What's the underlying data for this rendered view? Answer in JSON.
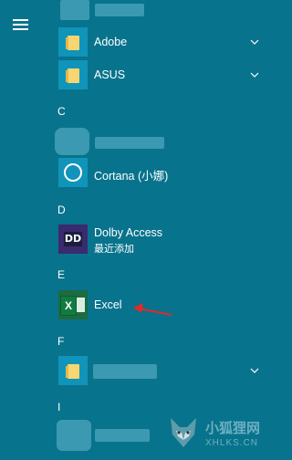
{
  "menu": {
    "hamburger_icon": "hamburger-menu-icon"
  },
  "sections": {
    "c": "C",
    "d": "D",
    "e": "E",
    "f": "F",
    "i": "I"
  },
  "apps": {
    "adobe": {
      "label": "Adobe",
      "icon": "folder-icon"
    },
    "asus": {
      "label": "ASUS",
      "icon": "folder-icon"
    },
    "cortana": {
      "label": "Cortana (小娜)",
      "icon": "cortana-icon"
    },
    "dolby": {
      "label": "Dolby Access",
      "sublabel": "最近添加",
      "icon_text": "DD"
    },
    "excel": {
      "label": "Excel",
      "icon_text": "X"
    }
  },
  "watermark": {
    "title": "小狐狸网",
    "url": "XHLKS.CN"
  },
  "colors": {
    "background": "#08738c",
    "tile": "#1194b9",
    "folder": "#f8d570",
    "arrow": "#e02a2a"
  }
}
